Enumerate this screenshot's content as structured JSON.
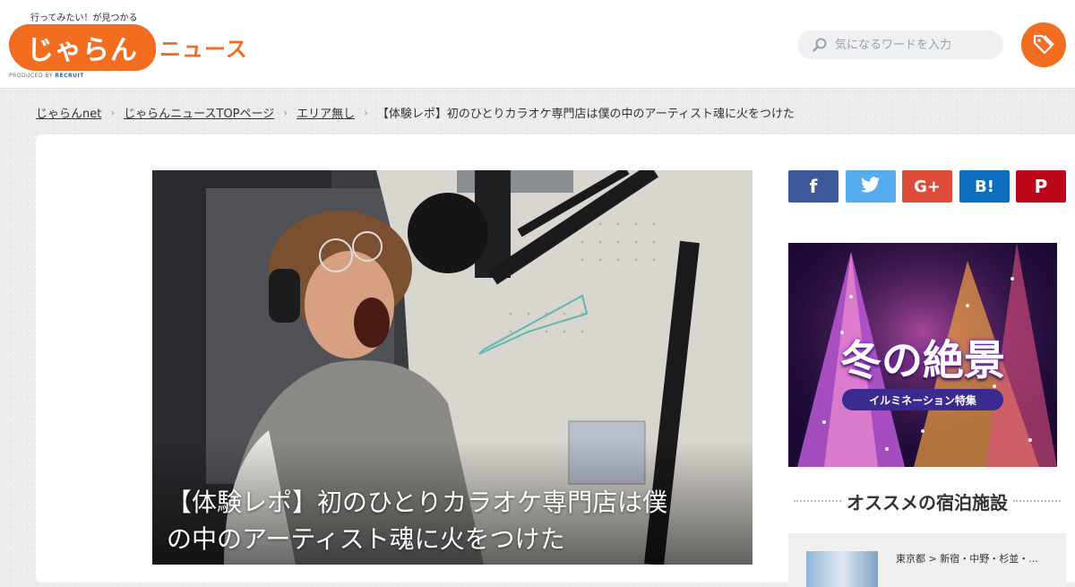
{
  "header": {
    "tagline": "行ってみたい！が見つかる",
    "logo_text": "じゃらん",
    "logo_suffix": "ニュース",
    "produced_by": "PRODUCED BY",
    "produced_brand": "RECRUIT",
    "search_placeholder": "気になるワードを入力"
  },
  "breadcrumb": {
    "items": [
      {
        "label": "じゃらんnet"
      },
      {
        "label": "じゃらんニュースTOPページ"
      },
      {
        "label": "エリア無し"
      }
    ],
    "current": "【体験レポ】初のひとりカラオケ専門店は僕の中のアーティスト魂に火をつけた",
    "separator": "›"
  },
  "article": {
    "title_line1": "【体験レポ】初のひとりカラオケ専門店は僕",
    "title_line2": "の中のアーティスト魂に火をつけた"
  },
  "social": {
    "facebook": "f",
    "twitter": "twitter-icon",
    "googleplus": "G+",
    "hatena": "B!",
    "pinterest": "P"
  },
  "banner": {
    "title": "冬の絶景",
    "subtitle": "イルミネーション特集"
  },
  "sidebar": {
    "section_title": "オススメの宿泊施設",
    "hotel_location": "東京都 > 新宿・中野・杉並・..."
  },
  "colors": {
    "brand_orange": "#f26d1f",
    "facebook": "#3b5998",
    "twitter": "#55acee",
    "googleplus": "#dd4b39",
    "hatena": "#0c6ebd",
    "pinterest": "#bd081c"
  }
}
